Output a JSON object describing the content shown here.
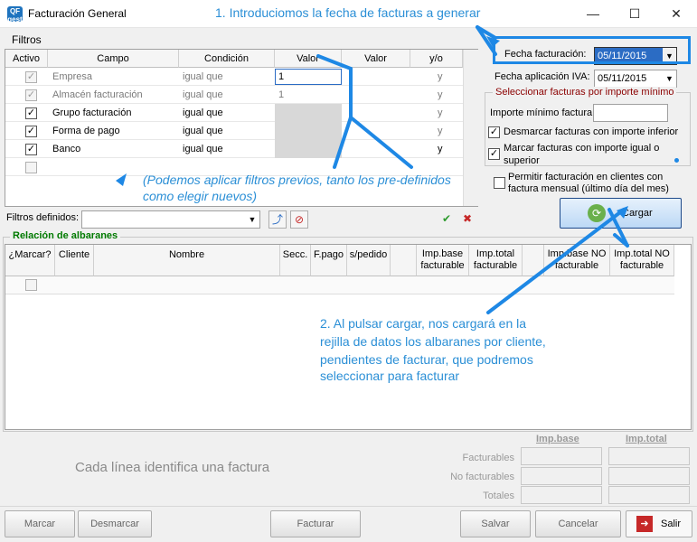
{
  "window": {
    "title": "Facturación General",
    "icon": "QF-app-icon"
  },
  "filtros": {
    "label": "Filtros",
    "columns": [
      "Activo",
      "Campo",
      "Condición",
      "Valor",
      "Valor",
      "y/o"
    ],
    "rows": [
      {
        "activo": true,
        "disabled": true,
        "campo": "Empresa",
        "condicion": "igual que",
        "valor": "1",
        "yo": "y"
      },
      {
        "activo": true,
        "disabled": true,
        "campo": "Almacén facturación",
        "condicion": "igual que",
        "valor": "1",
        "yo": "y"
      },
      {
        "activo": true,
        "disabled": false,
        "campo": "Grupo facturación",
        "condicion": "igual que",
        "valor": "",
        "yo": "y"
      },
      {
        "activo": true,
        "disabled": false,
        "campo": "Forma de pago",
        "condicion": "igual que",
        "valor": "",
        "yo": "y"
      },
      {
        "activo": true,
        "disabled": false,
        "campo": "Banco",
        "condicion": "igual que",
        "valor": "",
        "yo": "y"
      }
    ],
    "definidos_label": "Filtros definidos:"
  },
  "right_panel": {
    "fecha_facturacion_label": "Fecha facturación:",
    "fecha_facturacion_value": "05/11/2015",
    "fecha_iva_label": "Fecha aplicación IVA:",
    "fecha_iva_value": "05/11/2015",
    "importe_group_title": "Seleccionar facturas por importe mínimo",
    "importe_minimo_label": "Importe mínimo factura",
    "desmarcar_label": "Desmarcar facturas con importe inferior",
    "marcar_label_1": "Marcar facturas con importe igual o",
    "marcar_label_2": "superior",
    "permitir_label_1": "Permitir facturación en clientes con",
    "permitir_label_2": "factura mensual (último día del mes)",
    "cargar_label": "Cargar"
  },
  "albaranes": {
    "title": "Relación de albaranes",
    "columns": [
      {
        "l1": "¿Marcar?",
        "l2": ""
      },
      {
        "l1": "Cliente",
        "l2": ""
      },
      {
        "l1": "Nombre",
        "l2": ""
      },
      {
        "l1": "Secc.",
        "l2": ""
      },
      {
        "l1": "F.pago",
        "l2": ""
      },
      {
        "l1": "s/pedido",
        "l2": ""
      },
      {
        "l1": "",
        "l2": ""
      },
      {
        "l1": "Imp.base",
        "l2": "facturable"
      },
      {
        "l1": "Imp.total",
        "l2": "facturable"
      },
      {
        "l1": "",
        "l2": ""
      },
      {
        "l1": "Imp.base NO",
        "l2": "facturable"
      },
      {
        "l1": "Imp.total NO",
        "l2": "facturable"
      }
    ]
  },
  "totals": {
    "col_base": "Imp.base",
    "col_total": "Imp.total",
    "rows": [
      "Facturables",
      "No facturables",
      "Totales"
    ],
    "info_text": "Cada línea identifica una factura"
  },
  "buttons": {
    "marcar": "Marcar",
    "desmarcar": "Desmarcar",
    "facturar": "Facturar",
    "salvar": "Salvar",
    "cancelar": "Cancelar",
    "salir": "Salir"
  },
  "annotations": {
    "a1": "1. Introduciomos la fecha de facturas a generar",
    "a2_1": "(Podemos aplicar filtros previos, tanto los pre-definidos",
    "a2_2": "como elegir nuevos)",
    "a3_1": "2. Al pulsar cargar, nos cargará en la",
    "a3_2": "rejilla de datos los albaranes por cliente,",
    "a3_3": "pendientes de facturar, que podremos",
    "a3_4": "seleccionar para facturar"
  },
  "colors": {
    "annotation": "#2b8fd6",
    "section_title": "#007a00",
    "group_title": "#8b0000",
    "highlight": "#1e88e5"
  }
}
